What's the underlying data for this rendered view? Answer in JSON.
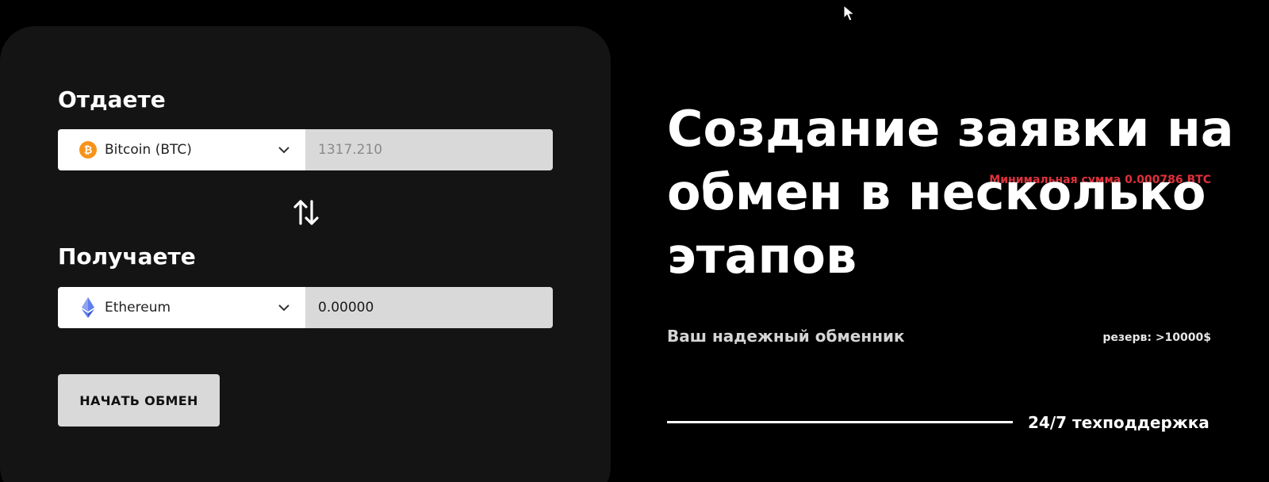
{
  "exchange_form": {
    "give": {
      "title": "Отдаете",
      "currency": "Bitcoin (BTC)",
      "currency_icon": "bitcoin-icon",
      "amount": "1317.210",
      "hint": "Минимальная сумма 0.000786 BTC"
    },
    "get": {
      "title": "Получаете",
      "currency": "Ethereum",
      "currency_icon": "ethereum-icon",
      "amount": "0.00000",
      "hint": "резерв: >10000$"
    },
    "swap_icon": "swap-arrows-icon",
    "start_button_label": "НАЧАТЬ ОБМЕН"
  },
  "hero": {
    "headline": "Создание заявки на обмен в несколько этапов",
    "subline": "Ваш надежный обменник",
    "support_label": "24/7 техподдержка"
  },
  "colors": {
    "background": "#000000",
    "card": "#141414",
    "error": "#e0303a",
    "bitcoin": "#f7931a",
    "ethereum": "#627eea"
  }
}
